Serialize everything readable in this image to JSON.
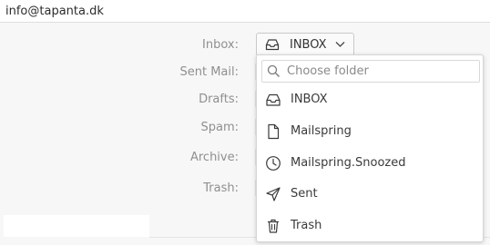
{
  "account": {
    "email": "info@tapanta.dk"
  },
  "roles": [
    {
      "label": "Inbox:"
    },
    {
      "label": "Sent Mail:"
    },
    {
      "label": "Drafts:"
    },
    {
      "label": "Spam:"
    },
    {
      "label": "Archive:"
    },
    {
      "label": "Trash:"
    }
  ],
  "inbox_select": {
    "value": "INBOX",
    "icon": "inbox-tray-icon"
  },
  "folder_dropdown": {
    "search_placeholder": "Choose folder",
    "items": [
      {
        "label": "INBOX",
        "icon": "inbox-tray-icon"
      },
      {
        "label": "Mailspring",
        "icon": "document-icon"
      },
      {
        "label": "Mailspring.Snoozed",
        "icon": "clock-icon"
      },
      {
        "label": "Sent",
        "icon": "paper-plane-icon"
      },
      {
        "label": "Trash",
        "icon": "trash-icon"
      }
    ]
  },
  "colors": {
    "label_gray": "#8f8f8f",
    "border": "#d6d6d6",
    "background": "#f7f7f7"
  }
}
